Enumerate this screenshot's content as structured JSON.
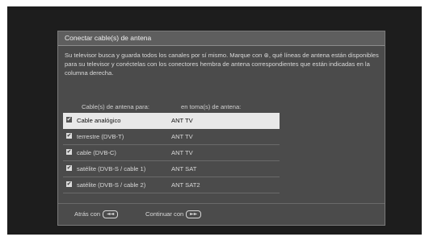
{
  "dialog": {
    "title": "Conectar cable(s) de antena",
    "description": "Su televisor busca y guarda todos los canales por sí mismo. Marque con ⊛, qué líneas de antena están disponibles para su televisor y conéctelas con los conectores hembra de antena correspondientes que están indicadas en la columna derecha.",
    "col_cable": "Cable(s) de antena para:",
    "col_port": "en toma(s) de antena:",
    "rows": [
      {
        "name": "Cable analógico",
        "port": "ANT TV",
        "checked": true
      },
      {
        "name": "terrestre (DVB-T)",
        "port": "ANT TV",
        "checked": true
      },
      {
        "name": "cable (DVB-C)",
        "port": "ANT TV",
        "checked": true
      },
      {
        "name": "satélite (DVB-S / cable 1)",
        "port": "ANT SAT",
        "checked": true
      },
      {
        "name": "satélite (DVB-S / cable 2)",
        "port": "ANT SAT2",
        "checked": true
      }
    ],
    "back_label": "Atrás con",
    "back_icon": "◄◄",
    "continue_label": "Continuar con",
    "continue_icon": "►►"
  },
  "check_glyph": "✔"
}
